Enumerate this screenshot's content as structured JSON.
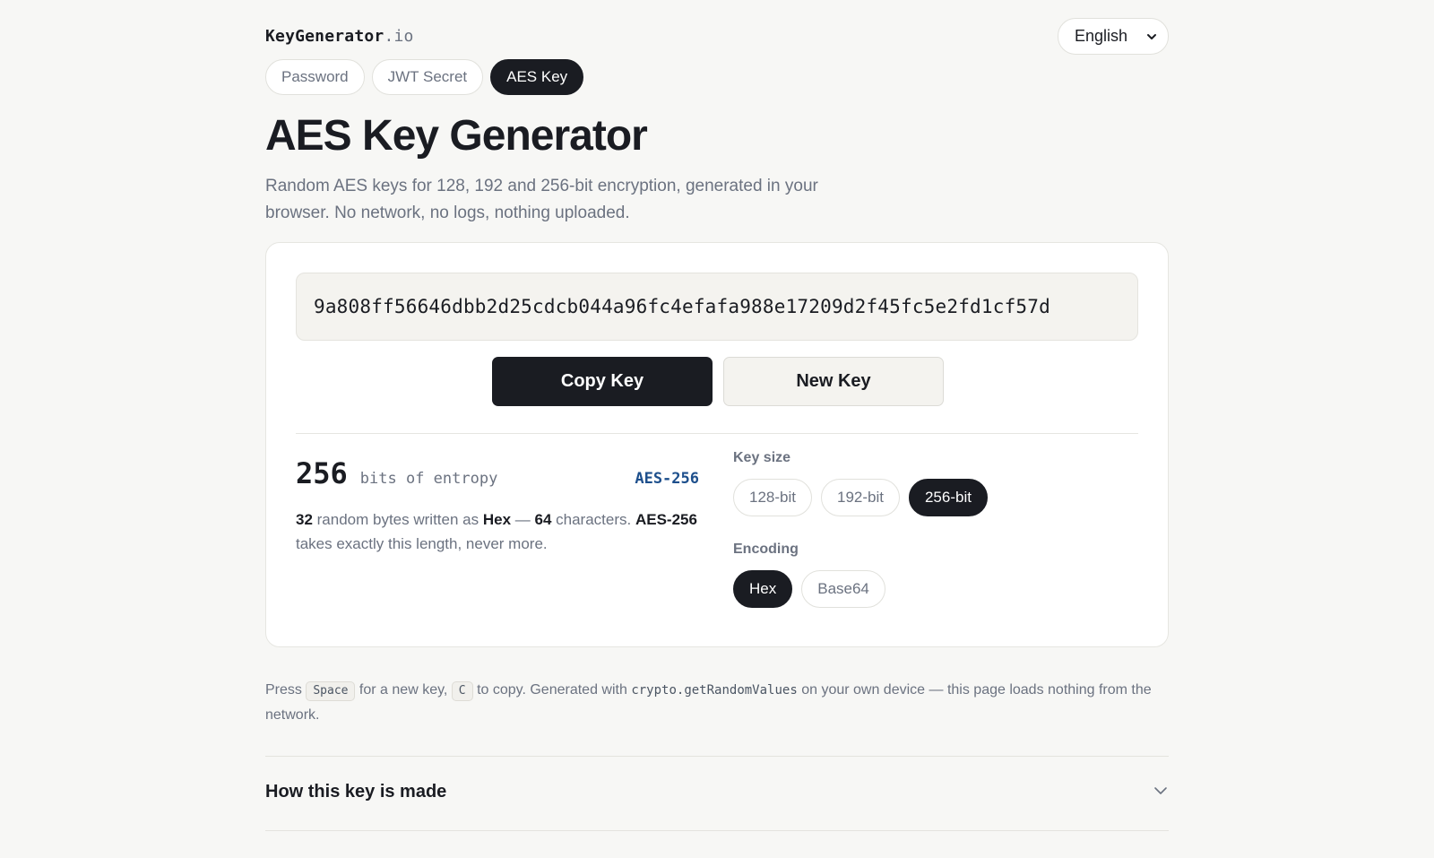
{
  "header": {
    "logo_name": "KeyGenerator",
    "logo_tld": ".io",
    "language": "English"
  },
  "tabs": [
    {
      "label": "Password",
      "active": false
    },
    {
      "label": "JWT Secret",
      "active": false
    },
    {
      "label": "AES Key",
      "active": true
    }
  ],
  "page": {
    "title": "AES Key Generator",
    "subtitle": "Random AES keys for 128, 192 and 256-bit encryption, generated in your browser. No network, no logs, nothing uploaded."
  },
  "generator": {
    "key_value": "9a808ff56646dbb2d25cdcb044a96fc4efafa988e17209d2f45fc5e2fd1cf57d",
    "copy_label": "Copy Key",
    "new_label": "New Key",
    "entropy_bits": "256",
    "entropy_label": "bits of entropy",
    "algorithm": "AES-256",
    "desc": {
      "bytes": "32",
      "t1": " random bytes written as ",
      "encoding": "Hex",
      "t2": " — ",
      "chars": "64",
      "t3": " characters. ",
      "algo": "AES-256",
      "t4": " takes exactly this length, never more."
    }
  },
  "key_size": {
    "label": "Key size",
    "options": [
      "128-bit",
      "192-bit",
      "256-bit"
    ],
    "selected": "256-bit"
  },
  "encoding": {
    "label": "Encoding",
    "options": [
      "Hex",
      "Base64"
    ],
    "selected": "Hex"
  },
  "note": {
    "t1": "Press ",
    "key_space": "Space",
    "t2": " for a new key, ",
    "key_c": "C",
    "t3": " to copy. Generated with ",
    "code": "crypto.getRandomValues",
    "t4": " on your own device — this page loads nothing from the network."
  },
  "faq": {
    "title": "How this key is made"
  },
  "colors": {
    "background": "#f7f7f5",
    "primary": "#1a1c22",
    "muted": "#6b7280",
    "accent": "#1d4f8c"
  }
}
